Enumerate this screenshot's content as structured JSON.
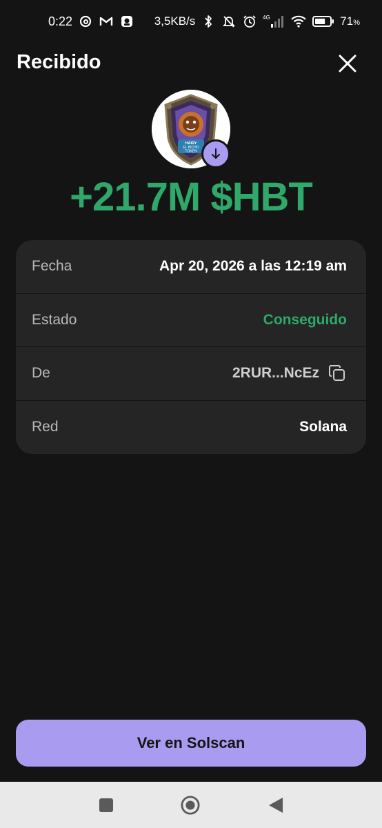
{
  "status_bar": {
    "time": "0:22",
    "net_speed": "3,5KB/s",
    "network_type": "4G",
    "battery_percent": "71",
    "battery_symbol": "%",
    "icons_left": [
      "threads-icon",
      "gmail-icon",
      "app-notification-icon"
    ],
    "icons_right": [
      "bluetooth-icon",
      "mute-icon",
      "alarm-icon",
      "signal-icon",
      "wifi-icon",
      "battery-icon"
    ],
    "battery_level": 0.71
  },
  "header": {
    "title": "Recibido"
  },
  "token": {
    "amount": "+21.7M $HBT",
    "logo_text": "HAIRY EL BICHO TOKEN",
    "amount_color": "#2fa86a"
  },
  "details": [
    {
      "label": "Fecha",
      "value": "Apr 20, 2026 a las 12:19 am"
    },
    {
      "label": "Estado",
      "value": "Conseguido"
    },
    {
      "label": "De",
      "value": "2RUR...NcEz"
    },
    {
      "label": "Red",
      "value": "Solana"
    }
  ],
  "actions": {
    "solscan_label": "Ver en Solscan",
    "accent_color": "#a99cf0"
  }
}
